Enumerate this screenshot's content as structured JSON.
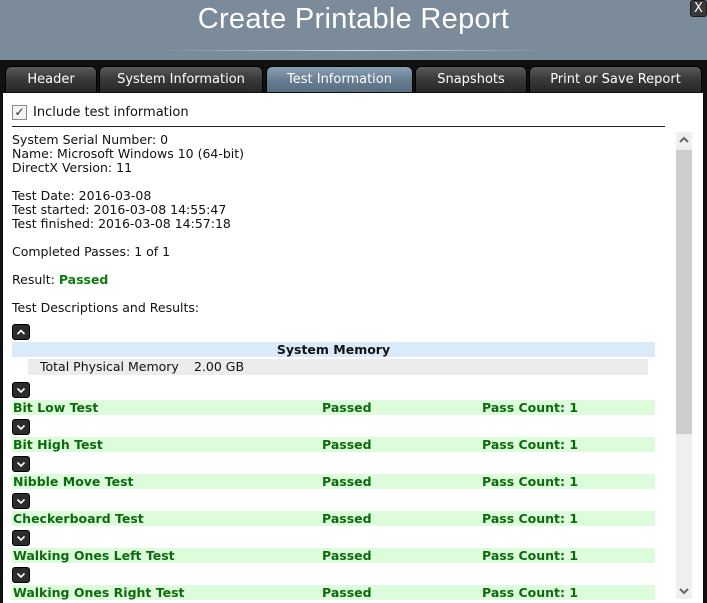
{
  "window": {
    "title": "Create Printable Report",
    "close_label": "X"
  },
  "tabs": [
    {
      "label": "Header",
      "active": false
    },
    {
      "label": "System Information",
      "active": false
    },
    {
      "label": "Test Information",
      "active": true
    },
    {
      "label": "Snapshots",
      "active": false
    },
    {
      "label": "Print or Save Report",
      "active": false
    }
  ],
  "include": {
    "label": "Include test information",
    "checked": true,
    "check_glyph": "✓"
  },
  "info": {
    "serial": "System Serial Number: 0",
    "name": "Name: Microsoft Windows 10 (64-bit)",
    "directx": "DirectX Version: 11",
    "test_date": "Test Date: 2016-03-08",
    "test_started": "Test started: 2016-03-08 14:55:47",
    "test_finished": "Test finished: 2016-03-08 14:57:18",
    "completed_passes": "Completed Passes: 1 of 1",
    "result_label": "Result: ",
    "result_value": "Passed",
    "descriptions_heading": "Test Descriptions and Results:"
  },
  "system_memory": {
    "title": "System Memory",
    "expanded": true,
    "key": "Total Physical Memory",
    "value": "2.00 GB"
  },
  "tests": [
    {
      "name": "Bit Low Test",
      "status": "Passed",
      "count": "Pass Count: 1"
    },
    {
      "name": "Bit High Test",
      "status": "Passed",
      "count": "Pass Count: 1"
    },
    {
      "name": "Nibble Move Test",
      "status": "Passed",
      "count": "Pass Count: 1"
    },
    {
      "name": "Checkerboard Test",
      "status": "Passed",
      "count": "Pass Count: 1"
    },
    {
      "name": "Walking Ones Left Test",
      "status": "Passed",
      "count": "Pass Count: 1"
    },
    {
      "name": "Walking Ones Right Test",
      "status": "Passed",
      "count": "Pass Count: 1"
    }
  ],
  "colors": {
    "title_bar": "#7b8b99",
    "active_tab": "#6a8094",
    "passed_green": "#0d7d0d",
    "section_header_bg": "#dbeafb",
    "test_row_bg": "#dcfcdc"
  }
}
